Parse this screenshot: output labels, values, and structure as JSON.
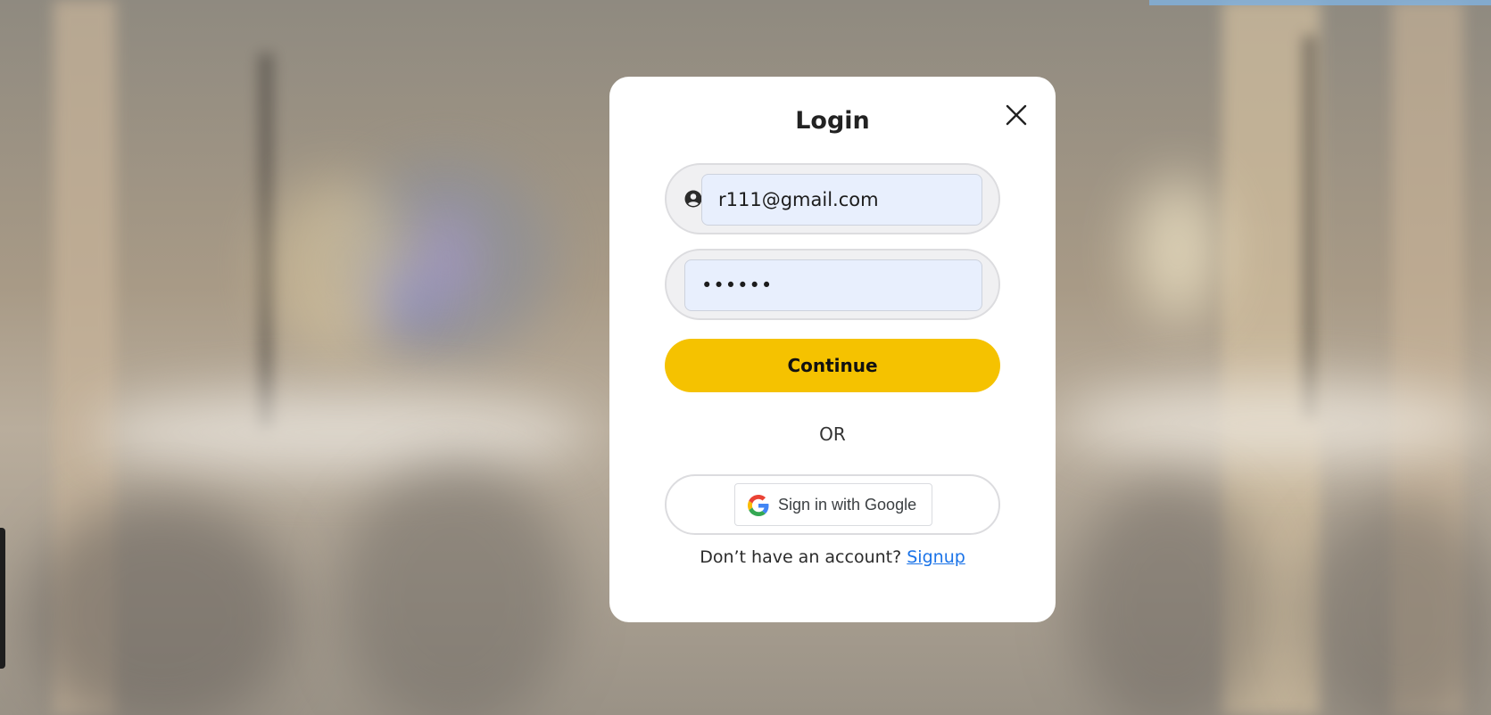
{
  "login": {
    "title": "Login",
    "email_value": "r111@gmail.com",
    "password_value": "••••••",
    "continue_label": "Continue",
    "or_text": "OR",
    "google_label": "Sign in with Google",
    "no_account_text": "Don’t have an account?",
    "signup_label": "Signup"
  },
  "icons": {
    "close": "close-icon",
    "user": "user-circle-icon",
    "google": "google-g-icon"
  },
  "colors": {
    "accent": "#f5c200",
    "link": "#1a73e8",
    "input_bg": "#e8effd"
  }
}
